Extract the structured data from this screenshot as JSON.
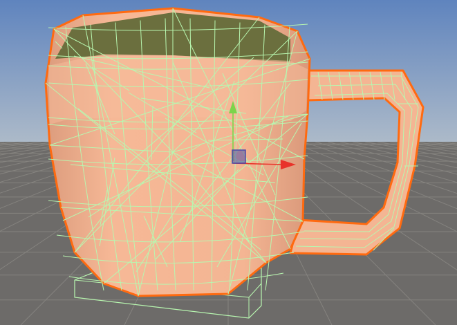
{
  "scene_view": {
    "sky_top_color": "#5f84be",
    "sky_horizon_color": "#aebbc9",
    "ground_color": "#6d6b69",
    "grid_color": "#85837f"
  },
  "selected_object": {
    "kind": "mug",
    "body_color": "#f4b593",
    "body_shadow_color": "#d9987a",
    "interior_color": "#6b6f3e",
    "wireframe_color": "#b8f7b0",
    "selection_outline_color": "#ff6a10"
  },
  "transform_gizmo": {
    "mode": "move",
    "icons": [
      "move-x-arrow-icon",
      "move-y-arrow-icon",
      "move-plane-handle-icon"
    ],
    "x_axis_color": "#e8332a",
    "y_axis_color": "#7bd44b",
    "plane_handle_color": "#4a4aa8"
  }
}
